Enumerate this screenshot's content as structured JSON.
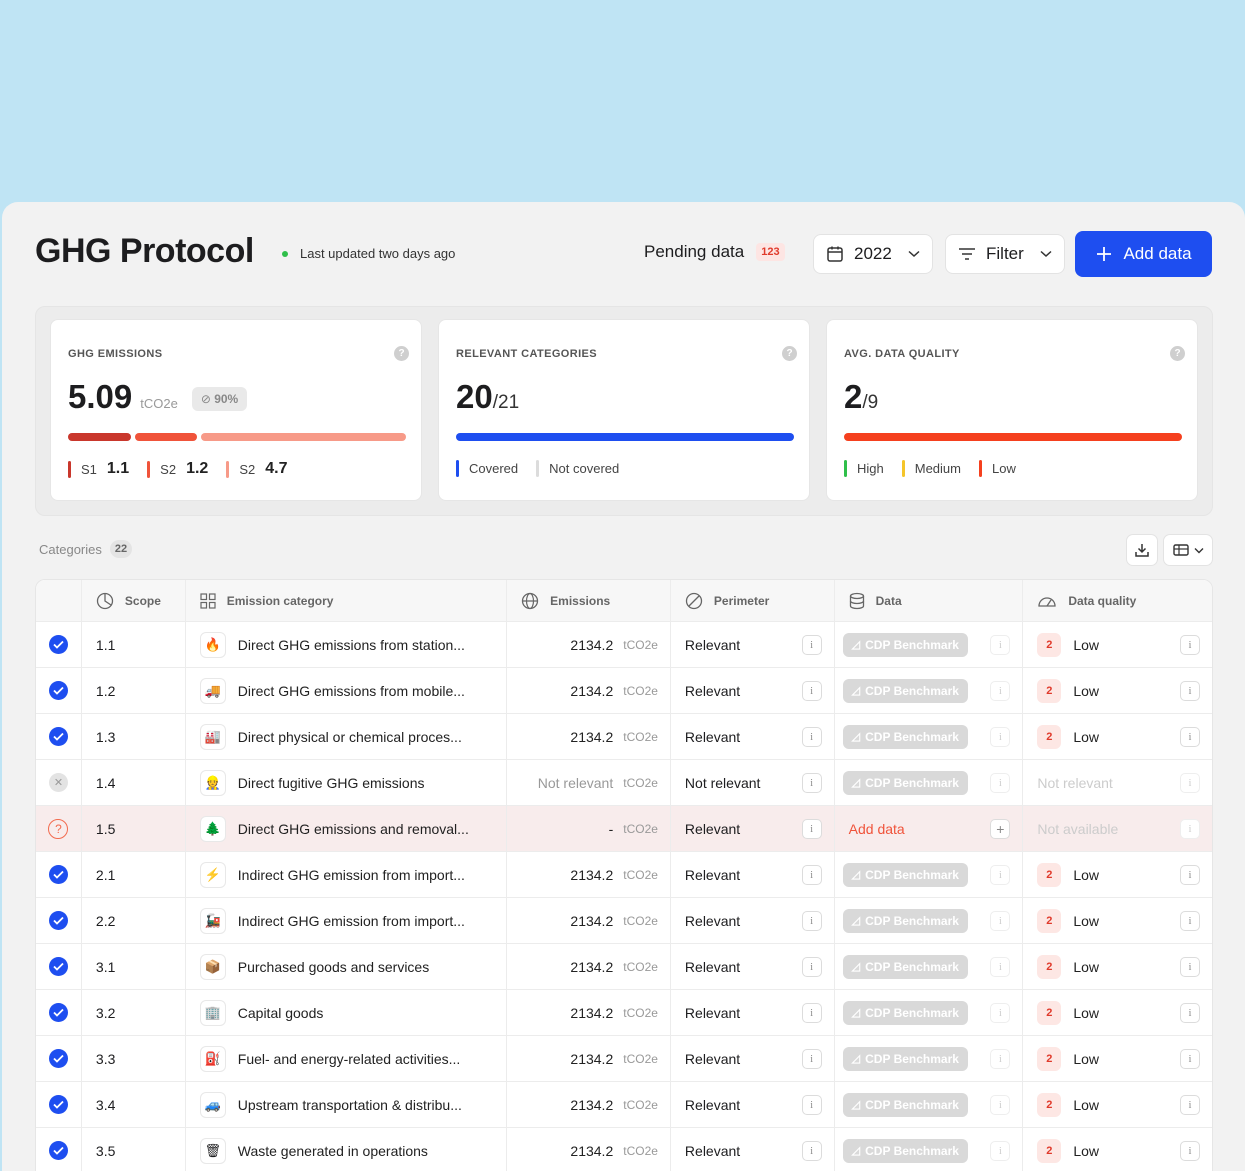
{
  "header": {
    "title": "GHG Protocol",
    "updated": "Last updated two days ago",
    "pending_label": "Pending data",
    "pending_count": "123",
    "year": "2022",
    "filter_label": "Filter",
    "add_label": "Add data"
  },
  "cards": [
    {
      "label": "GHG EMISSIONS",
      "value": "5.09",
      "unit": "tCO2e",
      "percent": "90%",
      "bar_segments": [
        {
          "color": "#c9372c",
          "fraction": 0.19
        },
        {
          "color": "#f0533a",
          "fraction": 0.19
        },
        {
          "color": "#f79a88",
          "fraction": 0.62
        }
      ],
      "legend": [
        {
          "label": "S1",
          "value": "1.1",
          "color": "#c9372c"
        },
        {
          "label": "S2",
          "value": "1.2",
          "color": "#f0533a"
        },
        {
          "label": "S2",
          "value": "4.7",
          "color": "#f79a88"
        }
      ]
    },
    {
      "label": "RELEVANT CATEGORIES",
      "value": "20",
      "denominator": "/21",
      "bar_segments": [
        {
          "color": "#1e4ef0",
          "fraction": 1
        }
      ],
      "legend": [
        {
          "label": "Covered",
          "color": "#1e4ef0"
        },
        {
          "label": "Not covered",
          "color": "#dcdcdc"
        }
      ]
    },
    {
      "label": "AVG. DATA QUALITY",
      "value": "2",
      "denominator": "/9",
      "bar_segments": [
        {
          "color": "#f5401e",
          "fraction": 1
        }
      ],
      "legend": [
        {
          "label": "High",
          "color": "#2fbf4a"
        },
        {
          "label": "Medium",
          "color": "#f5c52a"
        },
        {
          "label": "Low",
          "color": "#f5401e"
        }
      ]
    }
  ],
  "categories": {
    "label": "Categories",
    "count": "22"
  },
  "table": {
    "columns": [
      "Scope",
      "Emission category",
      "Emissions",
      "Perimeter",
      "Data",
      "Data quality"
    ],
    "rows": [
      {
        "status": "done",
        "scope": "1.1",
        "icon": "🔥",
        "category": "Direct GHG emissions from station...",
        "emissions": "2134.2",
        "unit": "tCO2e",
        "perimeter": "Relevant",
        "data": "CDP Benchmark",
        "dq": "2",
        "dq_label": "Low"
      },
      {
        "status": "done",
        "scope": "1.2",
        "icon": "🚚",
        "category": "Direct GHG emissions from mobile...",
        "emissions": "2134.2",
        "unit": "tCO2e",
        "perimeter": "Relevant",
        "data": "CDP Benchmark",
        "dq": "2",
        "dq_label": "Low"
      },
      {
        "status": "done",
        "scope": "1.3",
        "icon": "🏭",
        "category": "Direct physical or chemical proces...",
        "emissions": "2134.2",
        "unit": "tCO2e",
        "perimeter": "Relevant",
        "data": "CDP Benchmark",
        "dq": "2",
        "dq_label": "Low"
      },
      {
        "status": "skip",
        "scope": "1.4",
        "icon": "👷",
        "category": "Direct fugitive GHG emissions",
        "emissions": "Not relevant",
        "unit": "tCO2e",
        "perimeter": "Not relevant",
        "data": "CDP Benchmark",
        "dq": "",
        "dq_label": "Not relevant"
      },
      {
        "status": "warn",
        "scope": "1.5",
        "icon": "🌲",
        "category": "Direct GHG emissions and removal...",
        "emissions": "-",
        "unit": "tCO2e",
        "perimeter": "Relevant",
        "data": "Add data",
        "dq": "",
        "dq_label": "Not available"
      },
      {
        "status": "done",
        "scope": "2.1",
        "icon": "⚡",
        "category": "Indirect GHG emission from import...",
        "emissions": "2134.2",
        "unit": "tCO2e",
        "perimeter": "Relevant",
        "data": "CDP Benchmark",
        "dq": "2",
        "dq_label": "Low"
      },
      {
        "status": "done",
        "scope": "2.2",
        "icon": "🚂",
        "category": "Indirect GHG emission from import...",
        "emissions": "2134.2",
        "unit": "tCO2e",
        "perimeter": "Relevant",
        "data": "CDP Benchmark",
        "dq": "2",
        "dq_label": "Low"
      },
      {
        "status": "done",
        "scope": "3.1",
        "icon": "📦",
        "category": "Purchased goods and services",
        "emissions": "2134.2",
        "unit": "tCO2e",
        "perimeter": "Relevant",
        "data": "CDP Benchmark",
        "dq": "2",
        "dq_label": "Low"
      },
      {
        "status": "done",
        "scope": "3.2",
        "icon": "🏢",
        "category": "Capital goods",
        "emissions": "2134.2",
        "unit": "tCO2e",
        "perimeter": "Relevant",
        "data": "CDP Benchmark",
        "dq": "2",
        "dq_label": "Low"
      },
      {
        "status": "done",
        "scope": "3.3",
        "icon": "⛽",
        "category": "Fuel- and energy-related activities...",
        "emissions": "2134.2",
        "unit": "tCO2e",
        "perimeter": "Relevant",
        "data": "CDP Benchmark",
        "dq": "2",
        "dq_label": "Low"
      },
      {
        "status": "done",
        "scope": "3.4",
        "icon": "🚙",
        "category": "Upstream transportation & distribu...",
        "emissions": "2134.2",
        "unit": "tCO2e",
        "perimeter": "Relevant",
        "data": "CDP Benchmark",
        "dq": "2",
        "dq_label": "Low"
      },
      {
        "status": "done",
        "scope": "3.5",
        "icon": "🗑",
        "category": "Waste generated in operations",
        "emissions": "2134.2",
        "unit": "tCO2e",
        "perimeter": "Relevant",
        "data": "CDP Benchmark",
        "dq": "2",
        "dq_label": "Low"
      }
    ]
  }
}
